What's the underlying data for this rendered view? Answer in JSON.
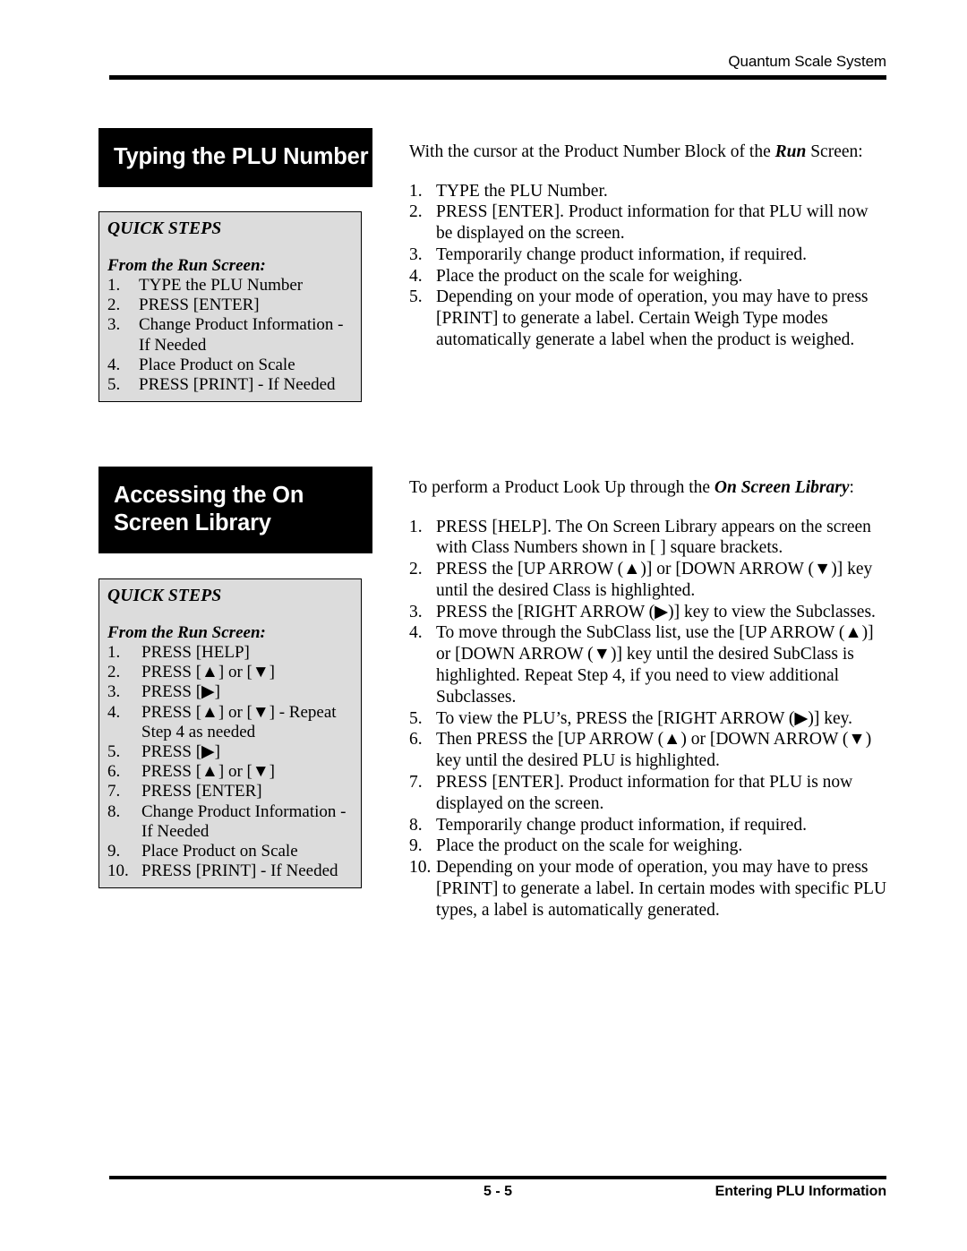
{
  "header": {
    "running_title": "Quantum Scale System"
  },
  "footer": {
    "page_number": "5 - 5",
    "chapter_title": "Entering PLU Information"
  },
  "sections": [
    {
      "banner_title": "Typing the PLU Number",
      "quick_steps": {
        "title": "QUICK STEPS",
        "subtitle": "From the Run Screen:",
        "items": [
          {
            "num": "1.",
            "text": "TYPE the PLU Number"
          },
          {
            "num": "2.",
            "text": "PRESS [ENTER]"
          },
          {
            "num": "3.",
            "text": "Change Product Information - If Needed"
          },
          {
            "num": "4.",
            "text": "Place Product on Scale"
          },
          {
            "num": "5.",
            "text": "PRESS [PRINT] - If Needed"
          }
        ]
      },
      "intro_html": "With the cursor at the Product Number Block of the <b>Run</b> Screen:",
      "steps": [
        {
          "num": "1.",
          "text": "TYPE the PLU Number."
        },
        {
          "num": "2.",
          "text": "PRESS [ENTER].  Product information for that PLU will now be displayed on the screen."
        },
        {
          "num": "3.",
          "text": "Temporarily change product information, if required."
        },
        {
          "num": "4.",
          "text": "Place the product on the scale for weighing."
        },
        {
          "num": "5.",
          "text": "Depending on your mode of operation, you may have to press [PRINT] to generate a label.  Certain Weigh Type modes automatically generate a label when the product is weighed."
        }
      ]
    },
    {
      "banner_title": "Accessing the On Screen  Library",
      "quick_steps": {
        "title": "QUICK STEPS",
        "subtitle": "From the Run Screen:",
        "items": [
          {
            "num": "1.",
            "text": "PRESS [HELP]"
          },
          {
            "num": "2.",
            "text": "PRESS [▲] or [▼]"
          },
          {
            "num": "3.",
            "text": "PRESS [▶]"
          },
          {
            "num": "4.",
            "text": "PRESS [▲] or [▼] - Repeat Step 4 as needed"
          },
          {
            "num": "5.",
            "text": "PRESS [▶]"
          },
          {
            "num": "6.",
            "text": "PRESS [▲] or [▼]"
          },
          {
            "num": "7.",
            "text": "PRESS [ENTER]"
          },
          {
            "num": "8.",
            "text": "Change Product Information - If Needed"
          },
          {
            "num": "9.",
            "text": "Place Product on Scale"
          },
          {
            "num": "10.",
            "text": "PRESS [PRINT] - If Needed"
          }
        ]
      },
      "intro_html": "To perform a Product Look Up through the <b>On Screen Library</b>:",
      "steps": [
        {
          "num": "1.",
          "text": "PRESS [HELP].  The On Screen Library appears on the screen with Class Numbers shown in [   ] square brackets."
        },
        {
          "num": "2.",
          "text": "PRESS the [UP ARROW (▲)] or [DOWN ARROW (▼)] key until the desired Class is highlighted."
        },
        {
          "num": "3.",
          "text": "PRESS the [RIGHT ARROW (▶)] key to view the Subclasses."
        },
        {
          "num": "4.",
          "text": "To move through the SubClass list, use the [UP ARROW (▲)] or [DOWN ARROW (▼)] key until the desired SubClass is highlighted. Repeat Step 4, if you need to view additional Subclasses."
        },
        {
          "num": "5.",
          "text": "To view the PLU’s, PRESS the [RIGHT ARROW (▶)] key."
        },
        {
          "num": "6.",
          "text": "Then PRESS the [UP ARROW (▲) or [DOWN ARROW (▼) key until the desired PLU is highlighted."
        },
        {
          "num": "7.",
          "text": "PRESS [ENTER].  Product information for that PLU is now displayed on the screen."
        },
        {
          "num": "8.",
          "text": "Temporarily change product information, if required."
        },
        {
          "num": "9.",
          "text": "Place the product on the scale for weighing."
        },
        {
          "num": "10.",
          "text": "Depending on your mode of operation, you may have to press [PRINT] to generate a label.  In certain modes with specific PLU types, a label is automatically generated."
        }
      ]
    }
  ]
}
